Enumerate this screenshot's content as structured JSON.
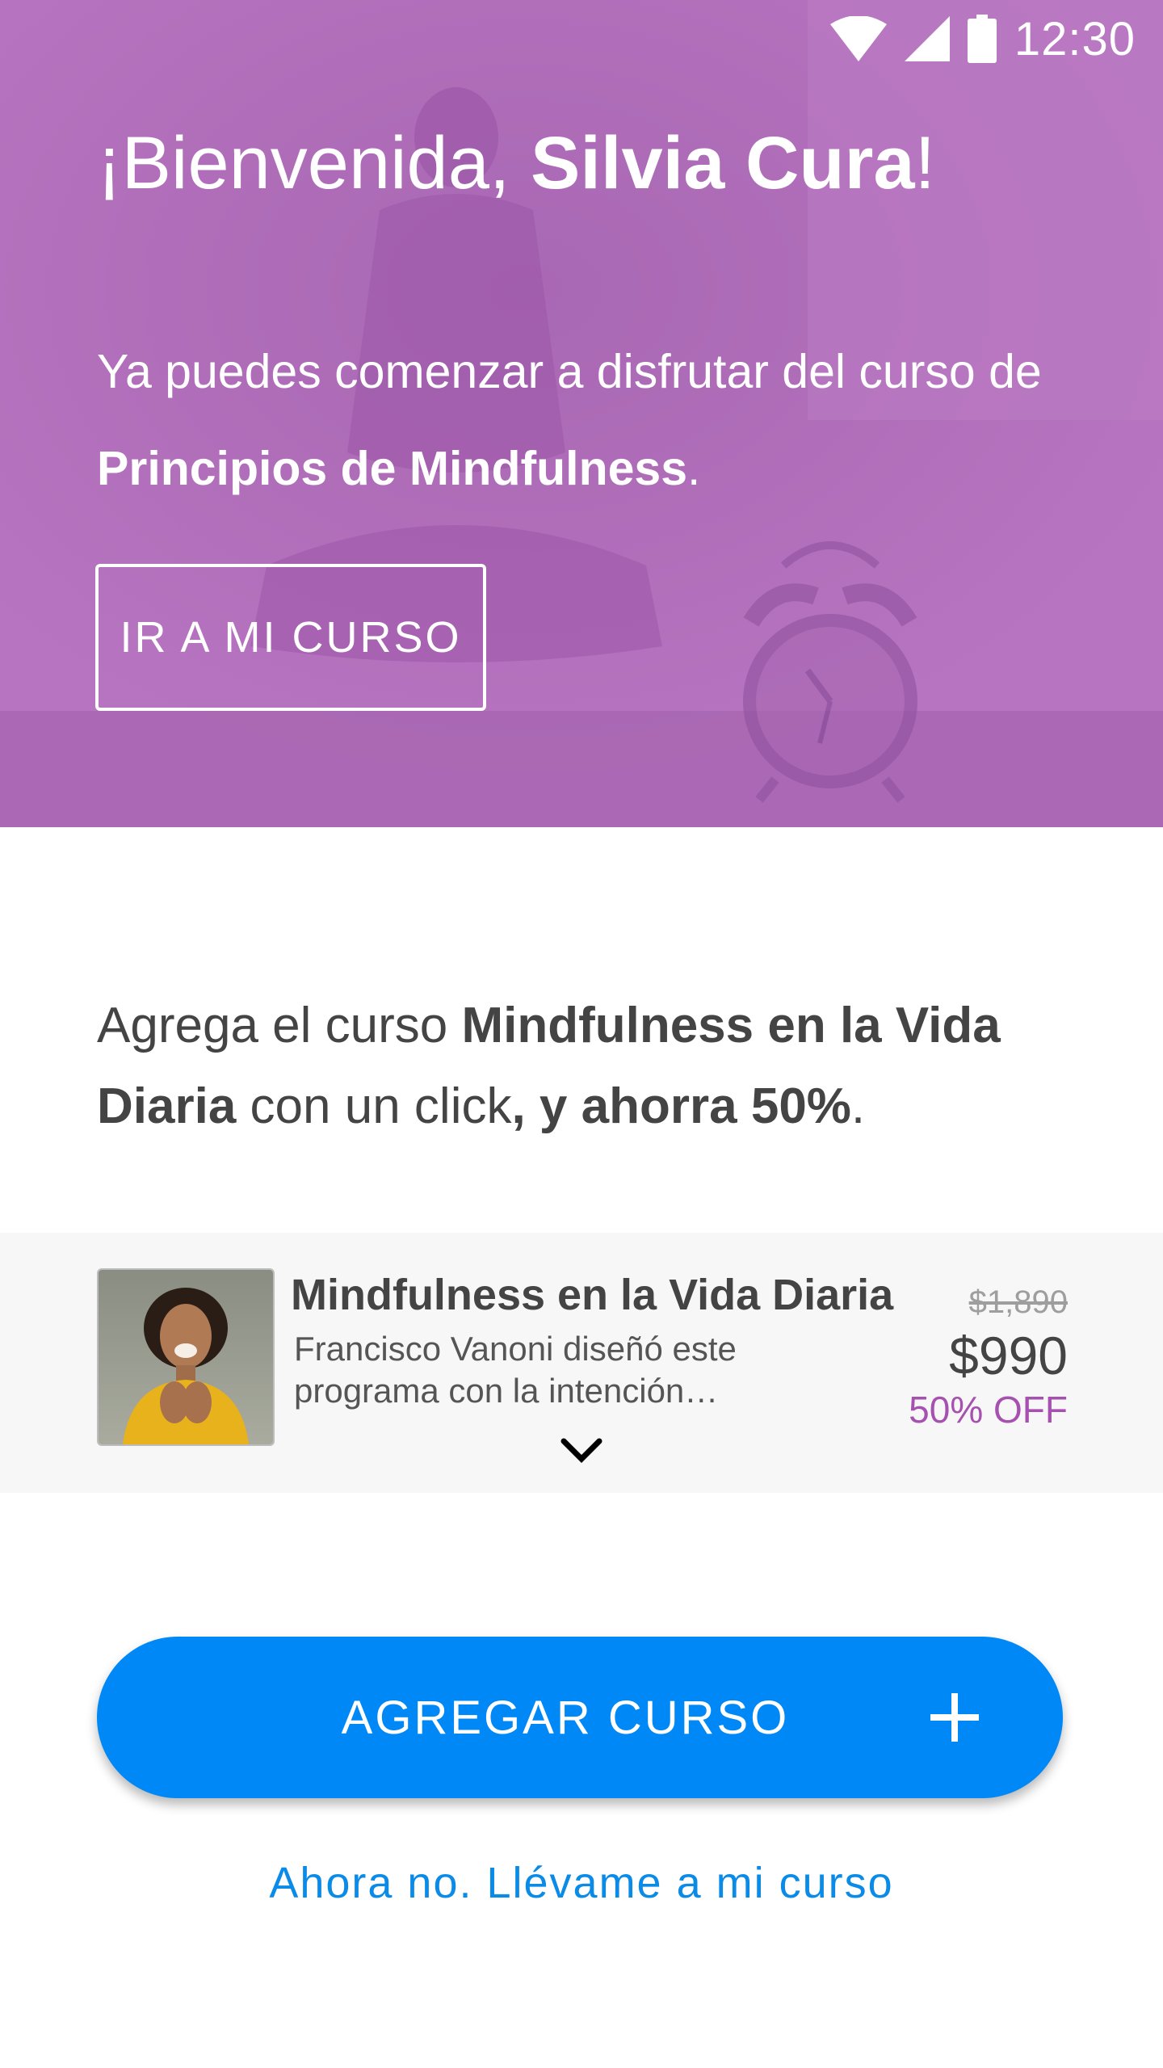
{
  "status_bar": {
    "time": "12:30"
  },
  "hero": {
    "greeting_prefix": "¡Bienvenida, ",
    "user_name": "Silvia Cura",
    "greeting_suffix": "!",
    "intro_text": "Ya puedes comenzar a disfrutar del curso de ",
    "course_name": "Principios de Mindfulness",
    "intro_end": ".",
    "button_label": "IR A MI CURSO"
  },
  "upsell": {
    "part1": "Agrega el curso ",
    "course_name": "Mindfulness en la Vida Diaria",
    "part2": " con un click",
    "part3": ", y ahorra 50%",
    "part4": "."
  },
  "course_card": {
    "title": "Mindfulness en la Vida Diaria",
    "description": "Francisco Vanoni diseñó este programa con la intención…",
    "old_price": "$1,890",
    "price": "$990",
    "discount": "50% OFF",
    "thumbnail_icon": "instructor-photo",
    "expand_icon": "chevron-down-icon"
  },
  "cta": {
    "label": "AGREGAR CURSO",
    "icon": "plus-icon"
  },
  "skip_link": "Ahora no. Llévame a mi curso",
  "colors": {
    "hero_purple": "#b46fbd",
    "accent_purple": "#a651b0",
    "cta_blue": "#0088f7",
    "link_blue": "#0a8be8"
  }
}
